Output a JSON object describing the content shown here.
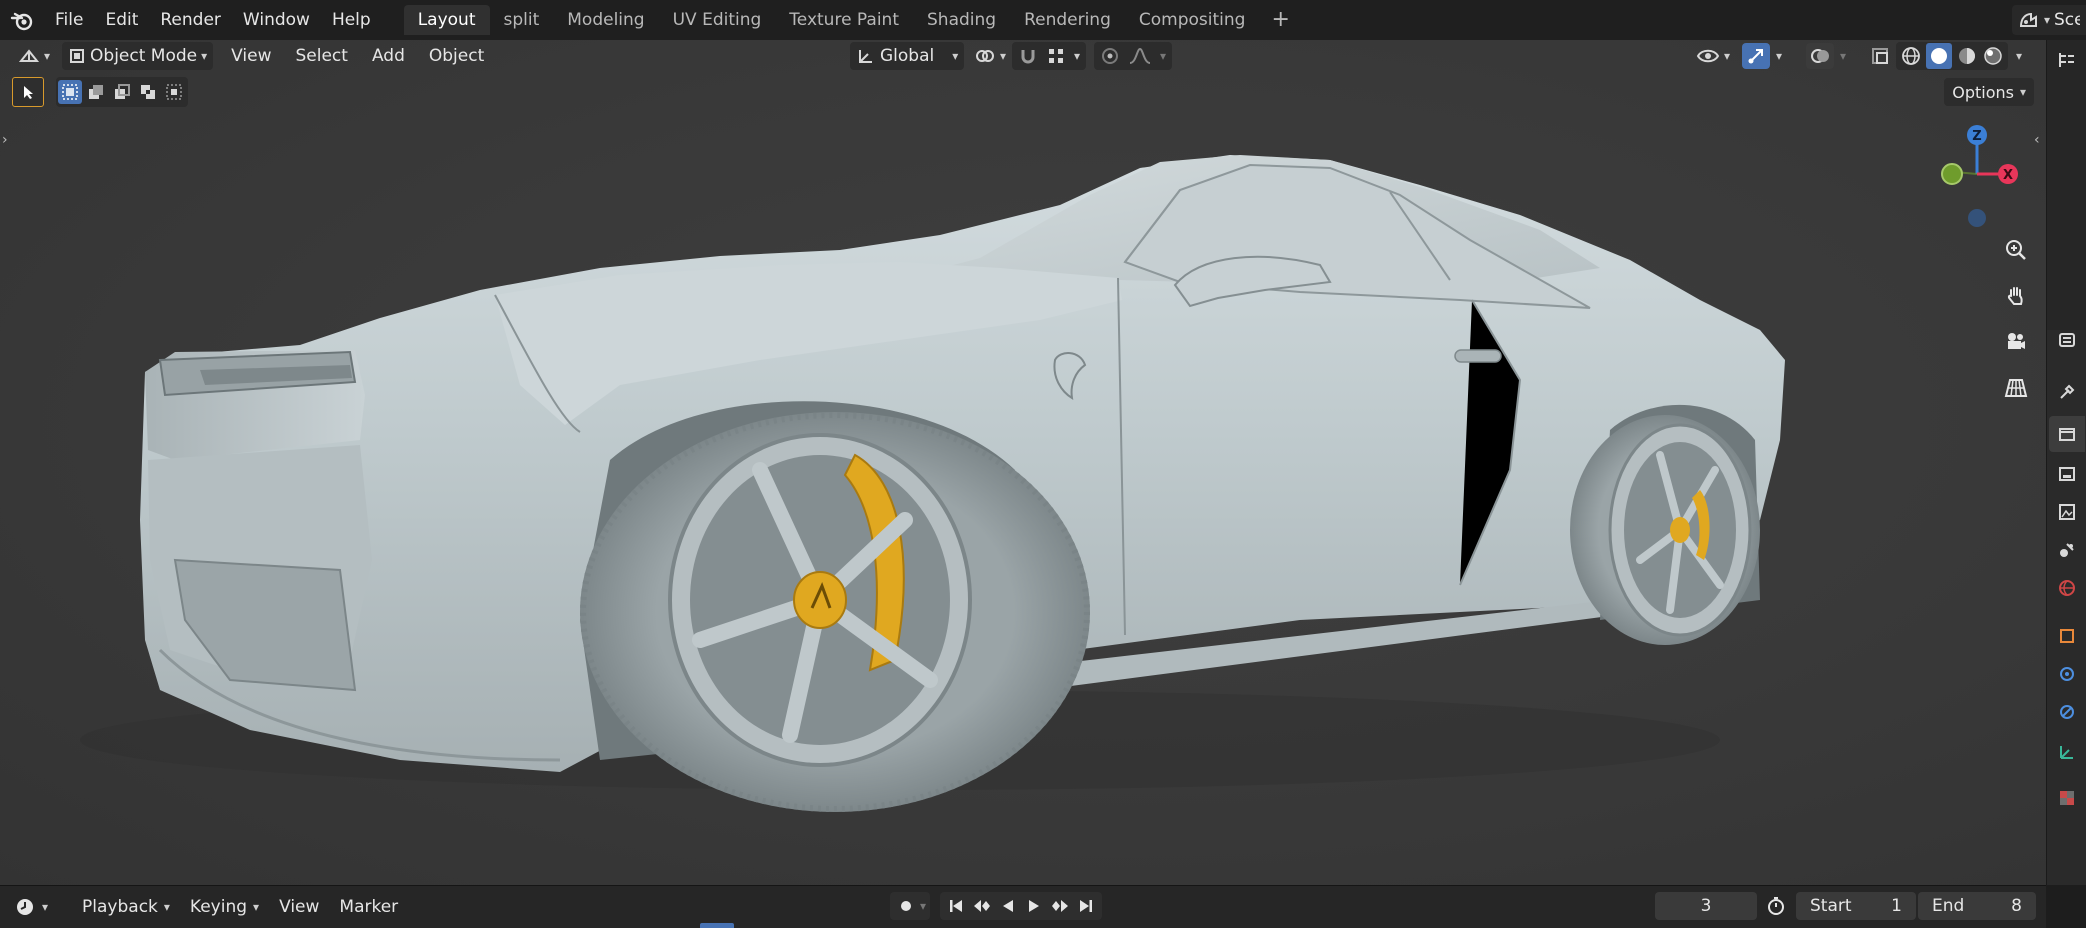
{
  "topbar": {
    "menus": [
      "File",
      "Edit",
      "Render",
      "Window",
      "Help"
    ],
    "workspaces": [
      "Layout",
      "split",
      "Modeling",
      "UV Editing",
      "Texture Paint",
      "Shading",
      "Rendering",
      "Compositing"
    ],
    "active_workspace": "Layout",
    "add_workspace": "+",
    "scene_label": "Sce"
  },
  "viewport_header": {
    "mode": "Object Mode",
    "menus": [
      "View",
      "Select",
      "Add",
      "Object"
    ],
    "orientation": "Global"
  },
  "options_label": "Options",
  "gizmo": {
    "z": "Z",
    "x": "X"
  },
  "timeline": {
    "menus": [
      "Playback",
      "Keying",
      "View",
      "Marker"
    ],
    "current_frame": "3",
    "start_label": "Start",
    "start_value": "1",
    "end_label": "End",
    "end_value": "8"
  },
  "colors": {
    "accent_blue": "#4772b3",
    "axis_x": "#e8365a",
    "axis_y": "#6f9c2c",
    "axis_z": "#3b7fd6",
    "caliper": "#e0a820"
  }
}
